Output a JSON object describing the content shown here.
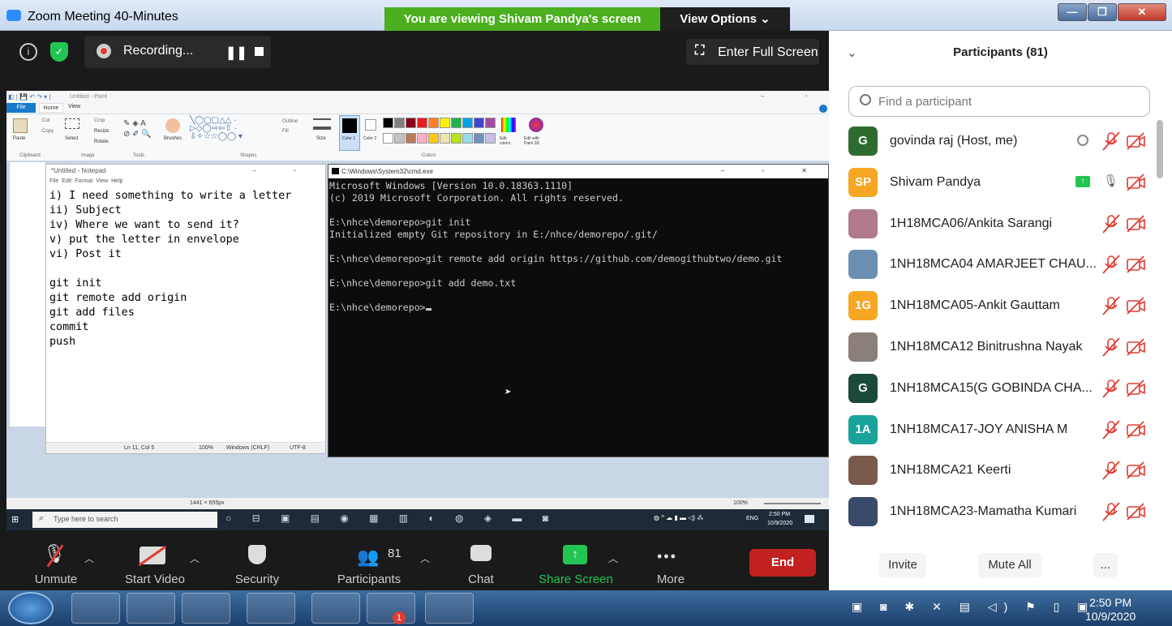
{
  "window": {
    "title": "Zoom Meeting 40-Minutes",
    "viewing_banner": "You are viewing Shivam Pandya's screen",
    "view_options": "View Options ⌄"
  },
  "top_toolbar": {
    "recording": "Recording...",
    "full_screen": "Enter Full Screen"
  },
  "paint": {
    "title": "Untitled - Paint",
    "tabs": [
      "File",
      "Home",
      "View"
    ],
    "groups": [
      "Clipboard",
      "Image",
      "Tools",
      "Shapes",
      "Colors"
    ],
    "buttons": {
      "paste": "Paste",
      "cut": "Cut",
      "copy": "Copy",
      "select": "Select",
      "crop": "Crop",
      "resize": "Resize",
      "rotate": "Rotate",
      "brushes": "Brushes",
      "outline": "Outline",
      "fill": "Fill",
      "size": "Size",
      "color1": "Color 1",
      "color2": "Color 2",
      "edit_colors": "Edit colors",
      "paint3d": "Edit with Paint 3D"
    },
    "status": {
      "dims": "1441 × 655px",
      "zoom": "100%"
    },
    "palette": [
      "#000000",
      "#7f7f7f",
      "#880015",
      "#ed1c24",
      "#ff7f27",
      "#fff200",
      "#22b14c",
      "#00a2e8",
      "#3f48cc",
      "#a349a4",
      "#ffffff",
      "#c3c3c3",
      "#b97a57",
      "#ffaec9",
      "#ffc90e",
      "#efe4b0",
      "#b5e61d",
      "#99d9ea",
      "#7092be",
      "#c8bfe7"
    ]
  },
  "notepad": {
    "title": "*Untitled - Notepad",
    "menu": [
      "File",
      "Edit",
      "Format",
      "View",
      "Help"
    ],
    "lines": [
      "i) I need something to write a letter",
      "ii) Subject",
      "iv) Where we want to send it?",
      "v) put the letter in envelope",
      "vi) Post it",
      "",
      "git init",
      "git remote add origin",
      "git add files",
      "commit",
      "push"
    ],
    "status": {
      "pos": "Ln 11, Col 5",
      "zoom": "100%",
      "eol": "Windows (CRLF)",
      "enc": "UTF-8"
    }
  },
  "cmd": {
    "title": "C:\\Windows\\System32\\cmd.exe",
    "lines": [
      "Microsoft Windows [Version 10.0.18363.1110]",
      "(c) 2019 Microsoft Corporation. All rights reserved.",
      "",
      "E:\\nhce\\demorepo>git init",
      "Initialized empty Git repository in E:/nhce/demorepo/.git/",
      "",
      "E:\\nhce\\demorepo>git remote add origin https://github.com/demogithubtwo/demo.git",
      "",
      "E:\\nhce\\demorepo>git add demo.txt",
      "",
      "E:\\nhce\\demorepo>"
    ]
  },
  "win10_taskbar": {
    "search": "Type here to search",
    "time": "2:50 PM",
    "date": "10/9/2020",
    "lang": "ENG"
  },
  "zoom_toolbar": {
    "unmute": "Unmute",
    "start_video": "Start Video",
    "security": "Security",
    "participants": "Participants",
    "participants_count": "81",
    "chat": "Chat",
    "share_screen": "Share Screen",
    "more": "More",
    "end": "End"
  },
  "participants_panel": {
    "header": "Participants (81)",
    "search_placeholder": "Find a participant",
    "list": [
      {
        "initials": "G",
        "color": "#2e6b2f",
        "name": "govinda raj (Host, me)"
      },
      {
        "initials": "SP",
        "color": "#f5a623",
        "name": "Shivam Pandya"
      },
      {
        "initials": "",
        "color": "#b07a8a",
        "name": "1H18MCA06/Ankita Sarangi"
      },
      {
        "initials": "",
        "color": "#6b8fb3",
        "name": "1NH18MCA04 AMARJEET CHAU..."
      },
      {
        "initials": "1G",
        "color": "#f5a623",
        "name": "1NH18MCA05-Ankit Gauttam"
      },
      {
        "initials": "",
        "color": "#8a7f7a",
        "name": "1NH18MCA12 Binitrushna Nayak"
      },
      {
        "initials": "G",
        "color": "#1c4a3a",
        "name": "1NH18MCA15(G GOBINDA CHA..."
      },
      {
        "initials": "1A",
        "color": "#1aa39a",
        "name": "1NH18MCA17-JOY ANISHA M"
      },
      {
        "initials": "",
        "color": "#7a5a4a",
        "name": "1NH18MCA21 Keerti"
      },
      {
        "initials": "",
        "color": "#3a4a6a",
        "name": "1NH18MCA23-Mamatha Kumari"
      }
    ],
    "invite": "Invite",
    "mute_all": "Mute All",
    "more": "..."
  },
  "win7_taskbar": {
    "time": "2:50 PM",
    "date": "10/9/2020",
    "zoom_badge": "1"
  }
}
